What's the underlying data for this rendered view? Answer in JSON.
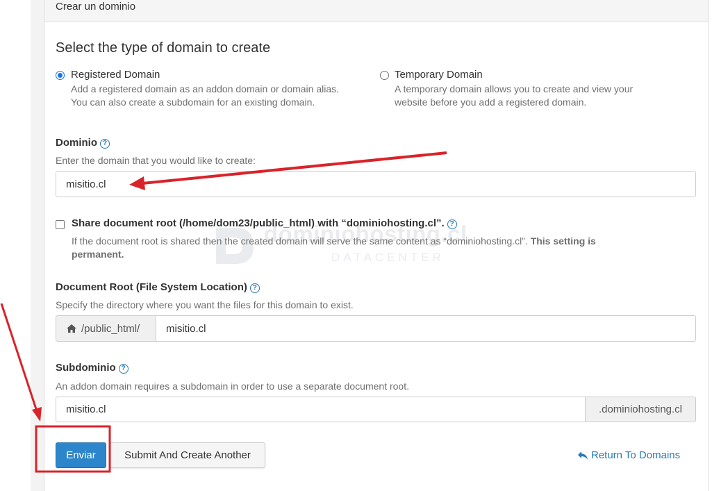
{
  "panel": {
    "heading": "Crear un dominio"
  },
  "type_section": {
    "title": "Select the type of domain to create",
    "registered": {
      "label": "Registered Domain",
      "desc_line1": "Add a registered domain as an addon domain or domain alias.",
      "desc_line2": "You can also create a subdomain for an existing domain."
    },
    "temporary": {
      "label": "Temporary Domain",
      "desc_line1": "A temporary domain allows you to create and view your",
      "desc_line2": "website before you add a registered domain."
    }
  },
  "domain": {
    "label": "Dominio",
    "help": "Enter the domain that you would like to create:",
    "value": "misitio.cl"
  },
  "share": {
    "label": "Share document root (/home/dom23/public_html) with “dominiohosting.cl”.",
    "desc_plain": "If the document root is shared then the created domain will serve the same content as “dominiohosting.cl”. ",
    "desc_bold1": "This setting is",
    "desc_bold2": "permanent."
  },
  "docroot": {
    "label": "Document Root (File System Location)",
    "help": "Specify the directory where you want the files for this domain to exist.",
    "prefix": "/public_html/",
    "value": "misitio.cl"
  },
  "subdomain": {
    "label": "Subdominio",
    "help": "An addon domain requires a subdomain in order to use a separate document root.",
    "value": "misitio.cl",
    "suffix": ".dominiohosting.cl"
  },
  "actions": {
    "submit": "Enviar",
    "submit_another": "Submit And Create Another",
    "return": "Return To Domains"
  },
  "watermark": {
    "main": "dominiohosting.cl",
    "sub": "DATACENTER"
  },
  "colors": {
    "primary": "#2d86cc",
    "link": "#2a7ab6",
    "annotation": "#d9232a"
  }
}
